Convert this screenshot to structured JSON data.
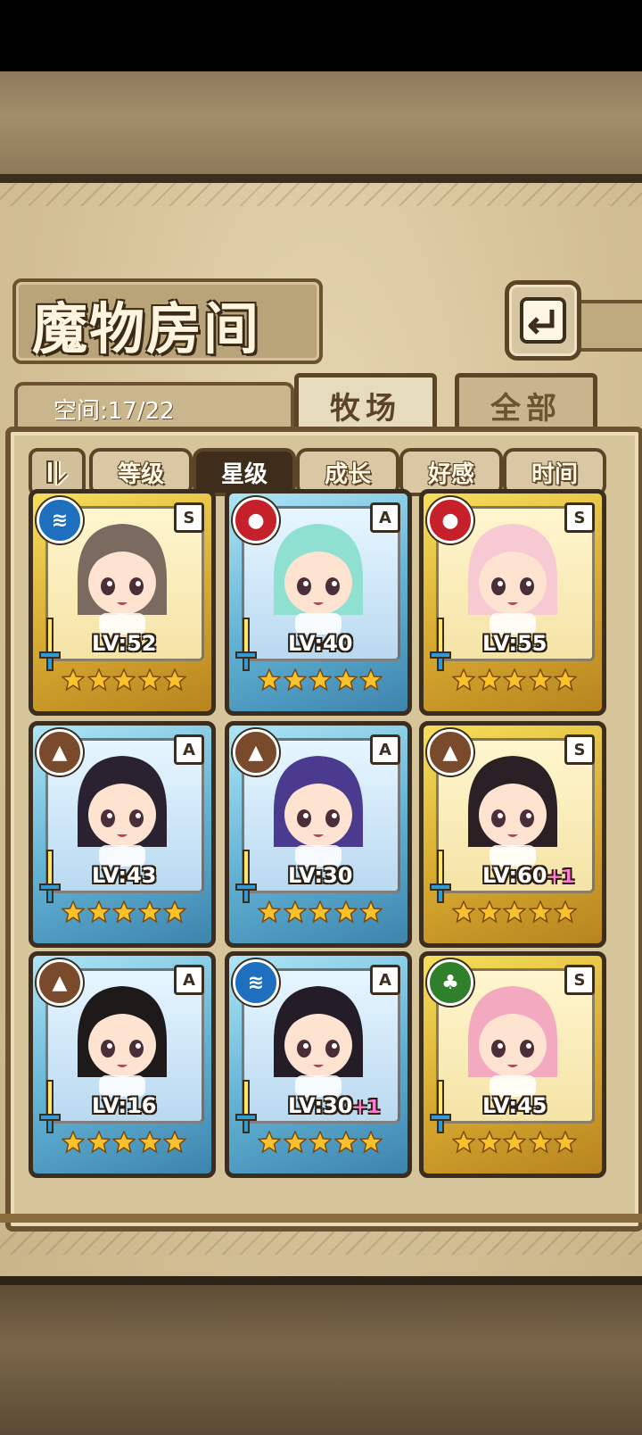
{
  "title": "魔物房间",
  "space": {
    "label": "空间:17/22"
  },
  "tabs": [
    {
      "label": "牧场",
      "active": true
    },
    {
      "label": "全部",
      "active": false
    }
  ],
  "filters": [
    {
      "label": "等级",
      "active": false
    },
    {
      "label": "星级",
      "active": true
    },
    {
      "label": "成长",
      "active": false
    },
    {
      "label": "好感",
      "active": false
    },
    {
      "label": "时间",
      "active": false
    }
  ],
  "colors": {
    "gold_card": "#f6df5d",
    "blue_card": "#5fb0d3",
    "frame_brown": "#5c4526",
    "star": "#f9c22a"
  },
  "monsters": [
    {
      "level": "LV:52",
      "plus": "",
      "rank": "S",
      "element": "water",
      "frame": "gold",
      "stars": 5,
      "hair": "#7a6a5f"
    },
    {
      "level": "LV:40",
      "plus": "",
      "rank": "A",
      "element": "fire",
      "frame": "blue",
      "stars": 5,
      "hair": "#8fe0d0"
    },
    {
      "level": "LV:55",
      "plus": "",
      "rank": "S",
      "element": "fire",
      "frame": "gold",
      "stars": 5,
      "hair": "#f6c9d3"
    },
    {
      "level": "LV:43",
      "plus": "",
      "rank": "A",
      "element": "earth",
      "frame": "blue",
      "stars": 5,
      "hair": "#2a2230"
    },
    {
      "level": "LV:30",
      "plus": "",
      "rank": "A",
      "element": "earth",
      "frame": "blue",
      "stars": 5,
      "hair": "#4b3b8f"
    },
    {
      "level": "LV:60",
      "plus": "+1",
      "rank": "S",
      "element": "earth",
      "frame": "gold",
      "stars": 5,
      "hair": "#2a2026"
    },
    {
      "level": "LV:16",
      "plus": "",
      "rank": "A",
      "element": "earth",
      "frame": "blue",
      "stars": 5,
      "hair": "#1f1a1a"
    },
    {
      "level": "LV:30",
      "plus": "+1",
      "rank": "A",
      "element": "water",
      "frame": "blue",
      "stars": 5,
      "hair": "#241c26"
    },
    {
      "level": "LV:45",
      "plus": "",
      "rank": "S",
      "element": "wood",
      "frame": "gold",
      "stars": 5,
      "hair": "#f3a9bf"
    }
  ]
}
